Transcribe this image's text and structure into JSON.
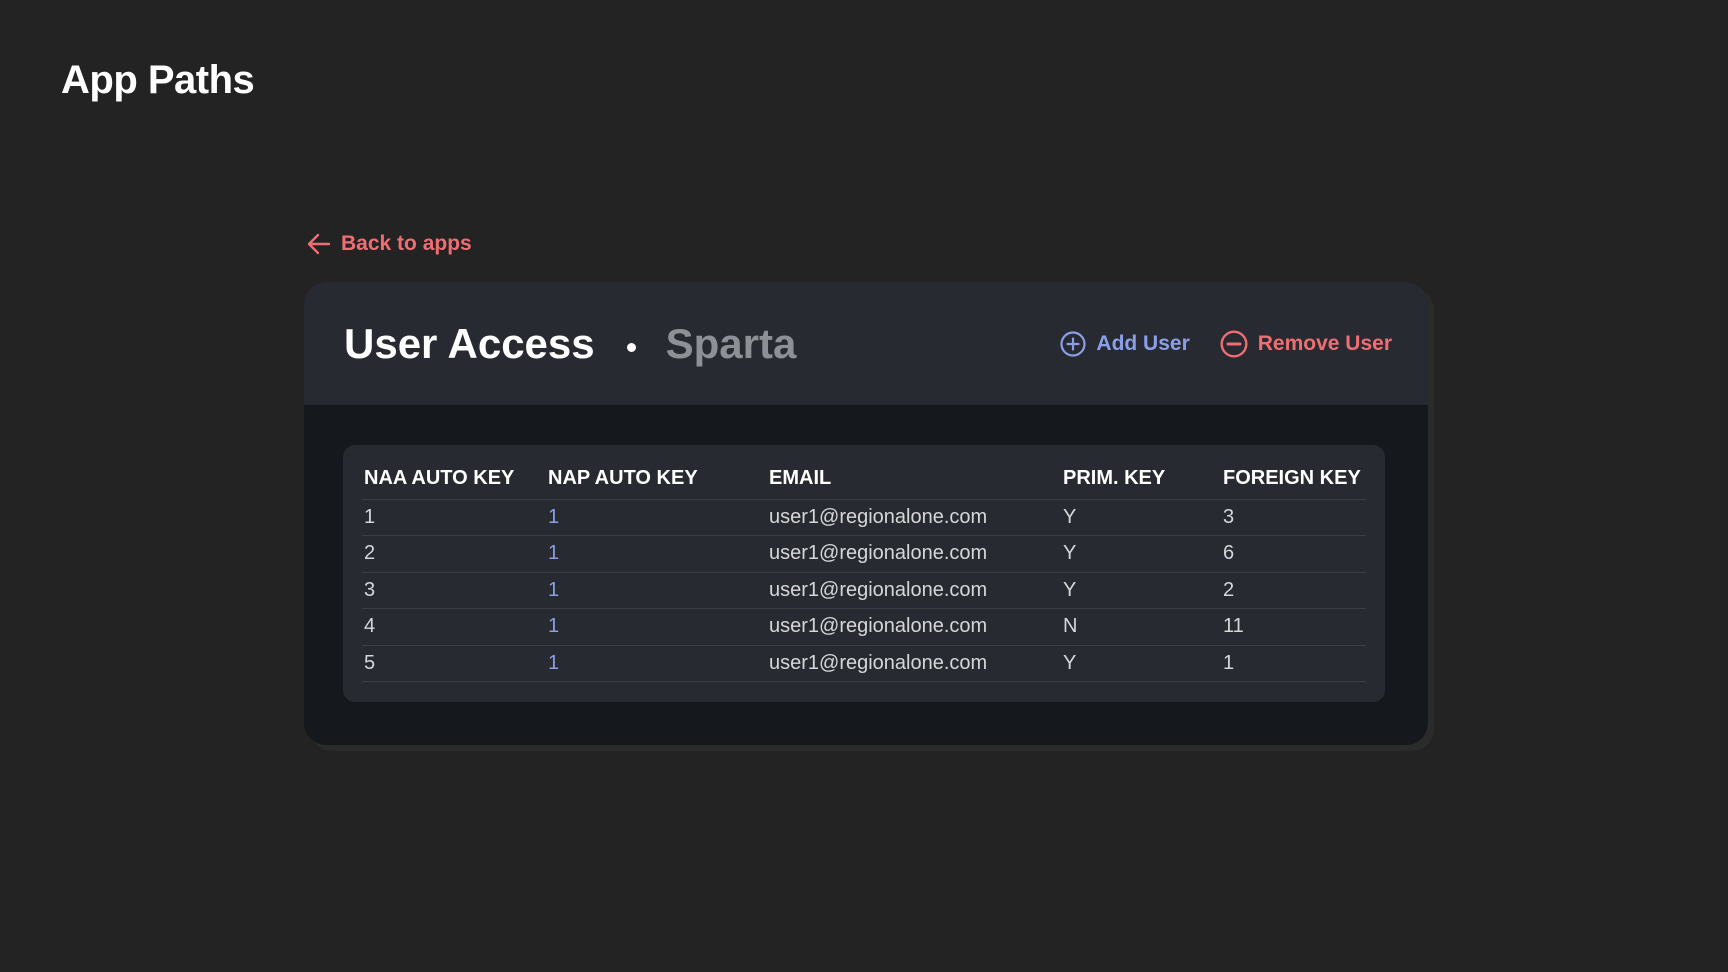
{
  "app": {
    "title": "App Paths"
  },
  "nav": {
    "back_label": "Back to apps"
  },
  "card": {
    "title": "User Access",
    "subtitle": "Sparta",
    "add_label": "Add User",
    "remove_label": "Remove User"
  },
  "table": {
    "headers": [
      "NAA AUTO KEY",
      "NAP AUTO KEY",
      "EMAIL",
      "PRIM. KEY",
      "FOREIGN KEY"
    ],
    "rows": [
      [
        "1",
        "1",
        "user1@regionalone.com",
        "Y",
        "3"
      ],
      [
        "2",
        "1",
        "user1@regionalone.com",
        "Y",
        "6"
      ],
      [
        "3",
        "1",
        "user1@regionalone.com",
        "Y",
        "2"
      ],
      [
        "4",
        "1",
        "user1@regionalone.com",
        "N",
        "11"
      ],
      [
        "5",
        "1",
        "user1@regionalone.com",
        "Y",
        "1"
      ]
    ]
  },
  "colors": {
    "background": "#232323",
    "panel": "#272a31",
    "card_body": "#15181c",
    "accent_red": "#ee6e73",
    "accent_blue": "#8b9fe6",
    "muted_text": "#8d9196"
  },
  "icons": {
    "back": "arrow-left-icon",
    "add": "plus-circle-icon",
    "remove": "minus-circle-icon"
  }
}
